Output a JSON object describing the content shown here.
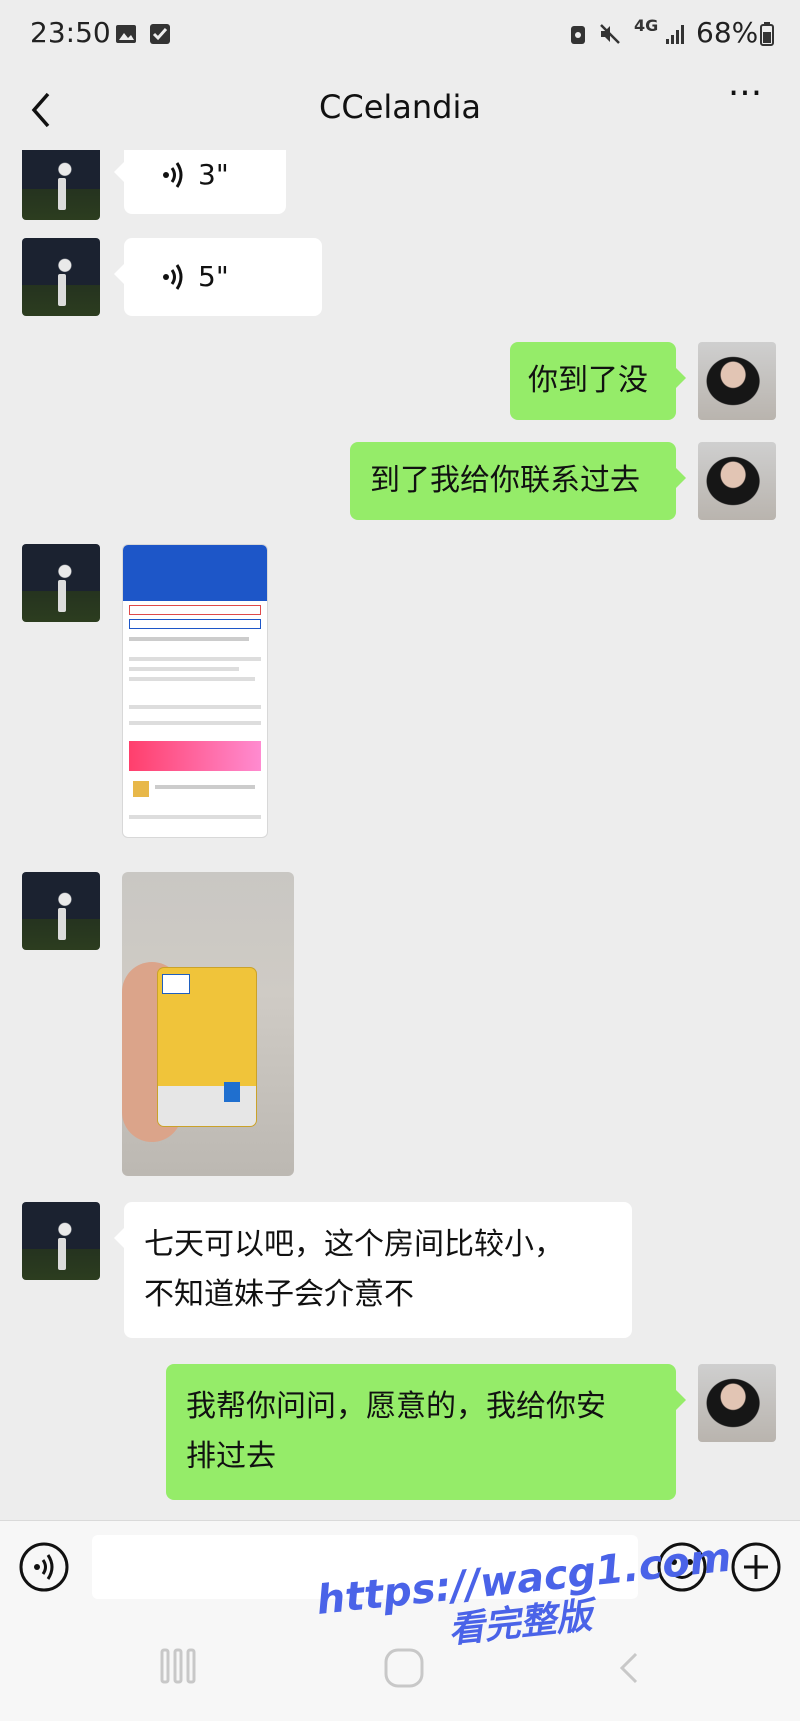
{
  "status_bar": {
    "time": "23:50",
    "network": "4G",
    "battery": "68%",
    "icons": [
      "gallery-icon",
      "checkbox-icon",
      "vpn-icon",
      "mute-icon",
      "signal-icon",
      "battery-icon"
    ]
  },
  "header": {
    "title": "CCelandia",
    "back_icon": "chevron-left-icon",
    "more_icon": "more-dots-icon",
    "more_label": "···"
  },
  "messages": [
    {
      "side": "left",
      "type": "voice",
      "duration": "3\""
    },
    {
      "side": "left",
      "type": "voice",
      "duration": "5\""
    },
    {
      "side": "right",
      "type": "text",
      "text": "你到了没"
    },
    {
      "side": "right",
      "type": "text",
      "text": "到了我给你联系过去"
    },
    {
      "side": "left",
      "type": "image",
      "description_icon": "screenshot-image"
    },
    {
      "side": "left",
      "type": "image",
      "description_icon": "hotel-keycard-photo"
    },
    {
      "side": "left",
      "type": "text",
      "lines": [
        "七天可以吧，这个房间比较小，",
        "不知道妹子会介意不"
      ]
    },
    {
      "side": "right",
      "type": "text",
      "lines": [
        "我帮你问问，愿意的，我给你安",
        "排过去"
      ]
    }
  ],
  "input_bar": {
    "voice_icon": "voice-input-icon",
    "emoji_icon": "emoji-icon",
    "plus_icon": "plus-icon",
    "text_value": ""
  },
  "nav_bar": {
    "icons": [
      "recent-apps-icon",
      "home-icon",
      "back-nav-icon"
    ]
  },
  "watermark": {
    "line1": "https://wacg1.com",
    "line2": "看完整版"
  },
  "colors": {
    "background": "#ededed",
    "green_bubble": "#95ec69",
    "white_bubble": "#ffffff",
    "watermark": "#4a63e8"
  }
}
